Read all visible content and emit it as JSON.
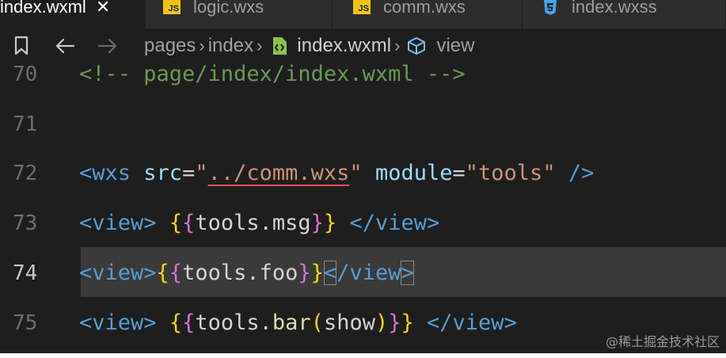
{
  "tabs": [
    {
      "label": "index.wxml",
      "active": true,
      "icon": "close-icon"
    },
    {
      "label": "logic.wxs",
      "icon": "js-file-icon",
      "badge": "JS"
    },
    {
      "label": "comm.wxs",
      "icon": "js-file-icon",
      "badge": "JS"
    },
    {
      "label": "index.wxss",
      "icon": "css-file-icon"
    }
  ],
  "breadcrumb": {
    "items": [
      "pages",
      "index",
      "index.wxml",
      "view"
    ]
  },
  "code": {
    "line_numbers": [
      "70",
      "71",
      "72",
      "73",
      "74",
      "75"
    ],
    "current_line": "74",
    "lines": {
      "l70": "<!-- page/index/index.wxml -->",
      "l72_src_attr": "src",
      "l72_src_value": "../comm.wxs",
      "l72_module_attr": "module",
      "l72_module_value": "tools",
      "l73_expr": "tools.msg",
      "l74_expr": "tools.foo",
      "l75_obj": "tools.",
      "l75_func": "bar",
      "l75_arg": "show"
    }
  },
  "watermark": "@稀土掘金技术社区",
  "colors": {
    "editor_bg": "#1e1e1e",
    "tag": "#569cd6",
    "string": "#ce9178",
    "comment": "#6a9955",
    "brace": "#ffd700"
  }
}
